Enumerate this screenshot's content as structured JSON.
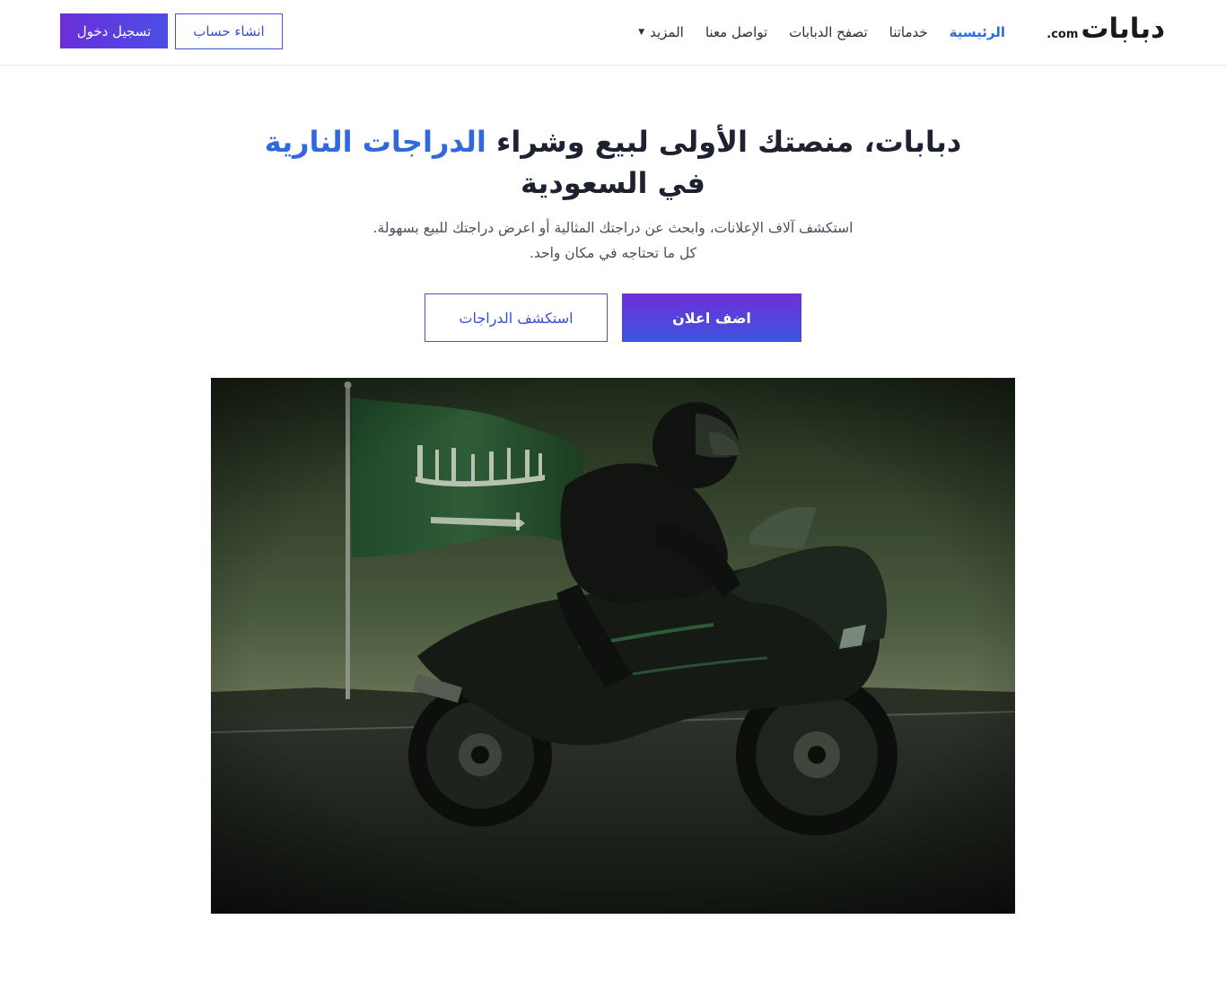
{
  "header": {
    "logo": {
      "name": "دبابات",
      "suffix": ".com"
    },
    "nav": {
      "home": "الرئيسية",
      "services": "خدماتنا",
      "browse": "تصفح الدبابات",
      "contact": "تواصل معنا",
      "more": "المزيد"
    },
    "auth": {
      "login": "تسجيل دخول",
      "register": "انشاء حساب"
    }
  },
  "hero": {
    "title_part1": "دبابات، منصتك الأولى لبيع وشراء",
    "title_accent": "الدراجات النارية",
    "title_part2": "في السعودية",
    "subtitle_line1": "استكشف آلاف الإعلانات، وابحث عن دراجتك المثالية أو اعرض دراجتك للبيع بسهولة.",
    "subtitle_line2": "كل ما تحتاجه في مكان واحد.",
    "cta_primary": "اضف اعلان",
    "cta_secondary": "استكشف الدراجات"
  },
  "theme": {
    "accent": "#3068e0",
    "gradient_start": "#6a2fd8",
    "gradient_end": "#4b4ee6"
  },
  "icons": {
    "more_caret": "caret-down-icon"
  }
}
